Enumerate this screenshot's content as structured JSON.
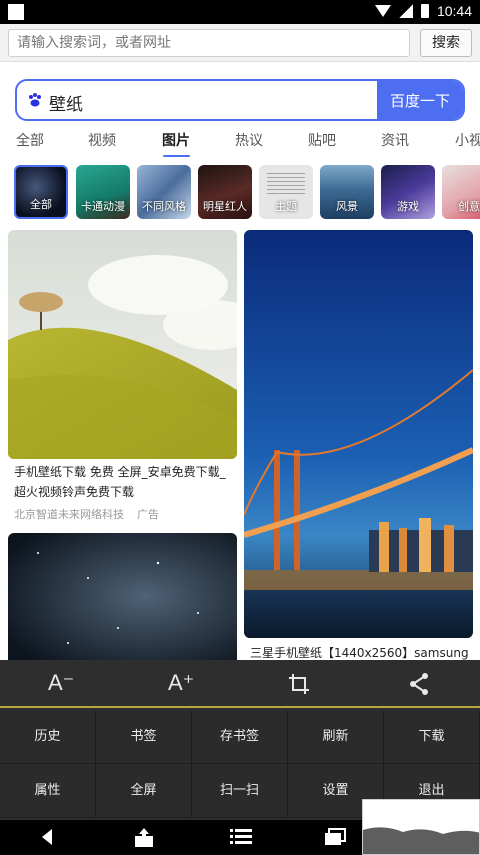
{
  "status": {
    "time": "10:44"
  },
  "address_bar": {
    "placeholder": "请输入搜索词，或者网址",
    "button": "搜索"
  },
  "search": {
    "query": "壁纸",
    "button": "百度一下"
  },
  "tabs": [
    "全部",
    "视频",
    "图片",
    "热议",
    "贴吧",
    "资讯",
    "小视"
  ],
  "active_tab": "图片",
  "categories": [
    "全部",
    "卡通动漫",
    "不同风格",
    "明星红人",
    "主题",
    "风景",
    "游戏",
    "创意"
  ],
  "cards": {
    "card1": {
      "title": "手机壁纸下载 免费 全屏_安卓免费下载_超火视频铃声免费下载",
      "source": "北京智道未来网络科技",
      "ad": "广告"
    },
    "card2": {
      "title": "三星手机壁纸【1440x2560】samsung"
    }
  },
  "menu": {
    "tools": [
      "A⁻",
      "A⁺",
      "crop-icon",
      "share-icon"
    ],
    "row1": [
      "历史",
      "书签",
      "存书签",
      "刷新",
      "下载"
    ],
    "row2": [
      "属性",
      "全屏",
      "扫一扫",
      "设置",
      "退出"
    ]
  },
  "colors": {
    "accent": "#4e6ef2",
    "menu_bg": "#2e2e2e",
    "divider": "#b8a53e"
  }
}
